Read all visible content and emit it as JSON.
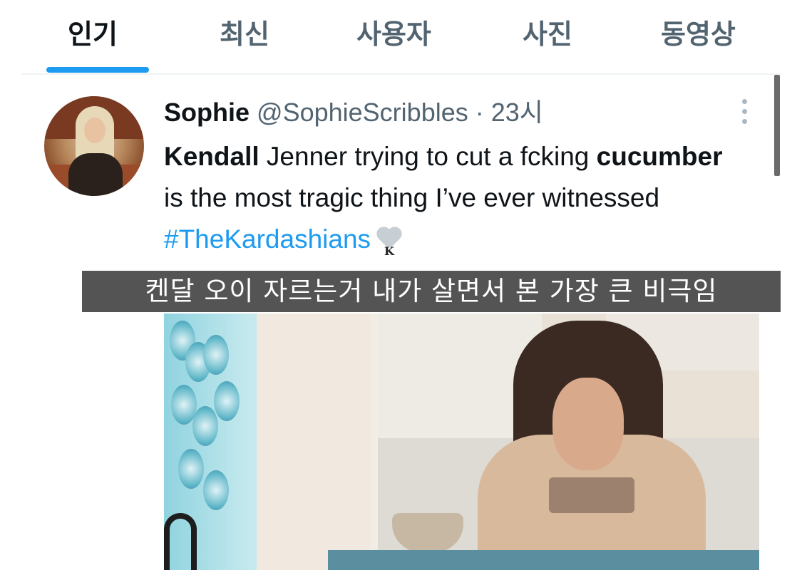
{
  "tabs": [
    {
      "label": "인기",
      "active": true
    },
    {
      "label": "최신",
      "active": false
    },
    {
      "label": "사용자",
      "active": false
    },
    {
      "label": "사진",
      "active": false
    },
    {
      "label": "동영상",
      "active": false
    }
  ],
  "tweet": {
    "name": "Sophie",
    "handle": "@SophieScribbles",
    "separator": "·",
    "time": "23시",
    "text": {
      "part1_bold": "Kendall",
      "part2": " Jenner trying to cut a fcking ",
      "part3_bold": "cucumber",
      "part4": " is the most tragic thing I’ve ever witnessed ",
      "hashtag": "#TheKardashians",
      "emoji_letter": "K"
    },
    "more_icon": "more-vertical-icon",
    "avatar": "avatar"
  },
  "subtitle": "켄달 오이 자르는거 내가 살면서 본 가장 큰 비극임",
  "colors": {
    "accent": "#1d9bf0",
    "text_primary": "#0f1419",
    "text_secondary": "#536471",
    "subtitle_bg": "#3c3c3c"
  }
}
